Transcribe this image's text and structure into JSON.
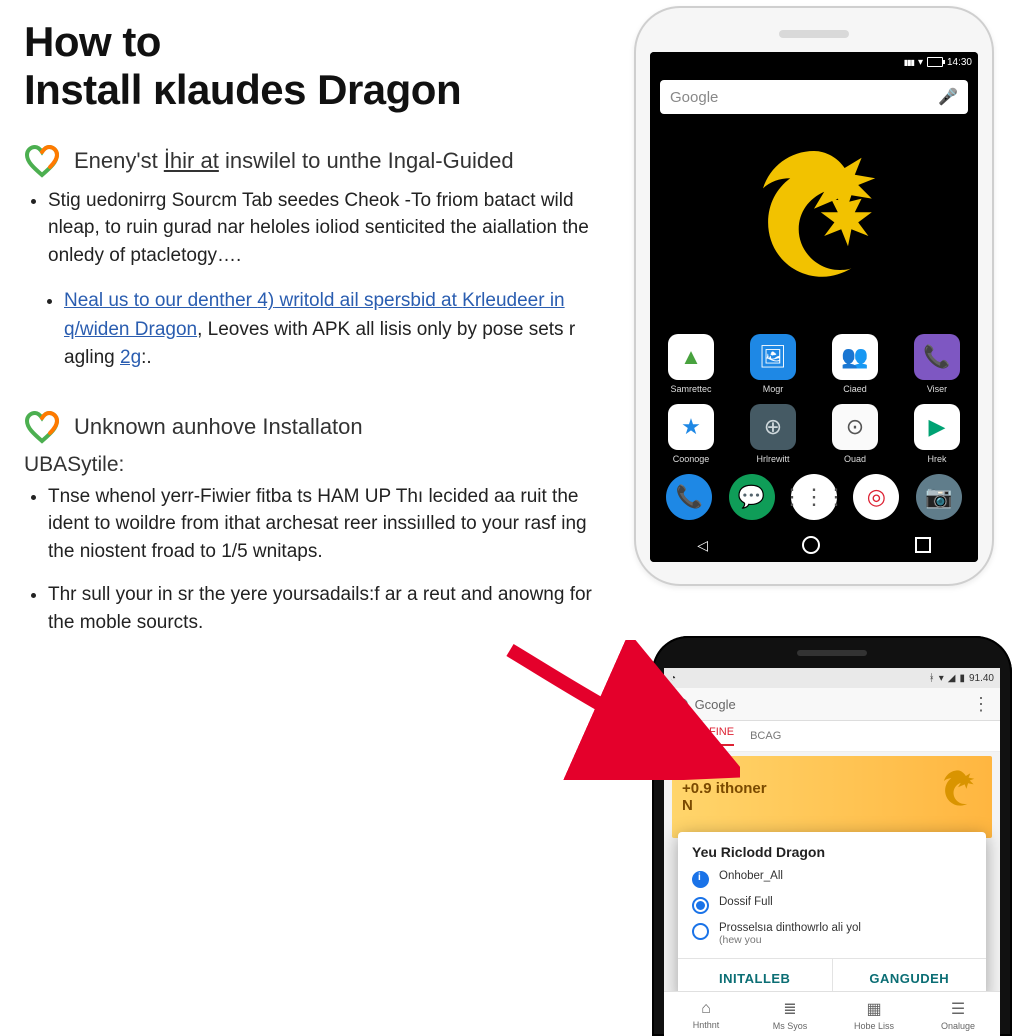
{
  "title_line1": "How to",
  "title_line2": "Install ĸlaudes Dragon",
  "step1": {
    "heading_pre": "Eneny'st ",
    "heading_link": "İhir at",
    "heading_post": " inswilel to unthe Ingal-Guided",
    "body": "Stig uedonirrg Sourcm Tab seedes Cheok -To friom batact wild nleap, to ruin gurad nar heloles ioliod senticited the aiallation the onledy of ptacletogy….",
    "subpoint_pre": "Neal us to our denther ",
    "subpoint_link1": "4)",
    "subpoint_mid1": " writold ail spersbid at ",
    "subpoint_link2": "Krleudeer in q/widen Dragon",
    "subpoint_mid2": ", Leoves with APK all lisis only by pose sets r agling ",
    "subpoint_link3": "2g",
    "subpoint_end": ":."
  },
  "step2": {
    "heading": "Unknown aunhove Installaton",
    "sublabel": "UBASytile:",
    "body1": "Tnse whenol yerr-Fiwier fitba ts HAM UP Thı lecided aa ruit the ident to woildre from ithat archesat reer inssiılled to your rasf ing the niostent froad to 1/5 wnitaps.",
    "body2": "Thr sull your in sr the yere yoursadails:f ar a reut and anowng for the moble sourcts."
  },
  "phone1": {
    "status_time": "14:30",
    "search_placeholder": "Google",
    "row1": [
      {
        "label": "Samrettec",
        "glyph": "▲",
        "bg": "#ffffff",
        "fg": "#48a23e"
      },
      {
        "label": "Mogr",
        "glyph": "🖼",
        "bg": "#1e88e5",
        "fg": "#fff"
      },
      {
        "label": "Ciaed",
        "glyph": "👥",
        "bg": "#fe2e2",
        "fg": "#333"
      },
      {
        "label": "Viser",
        "glyph": "📞",
        "bg": "#7e57c2",
        "fg": "#fff"
      }
    ],
    "row2": [
      {
        "label": "Coonoge",
        "glyph": "★",
        "bg": "#ffffff",
        "fg": "#1e88e5"
      },
      {
        "label": "Hrlrewitt",
        "glyph": "⊕",
        "bg": "#455a64",
        "fg": "#cfd8dc"
      },
      {
        "label": "Ouad",
        "glyph": "⊙",
        "bg": "#fafafa",
        "fg": "#555"
      },
      {
        "label": "Hrek",
        "glyph": "▶",
        "bg": "#ffffff",
        "fg": "#00a273"
      }
    ],
    "tray": [
      {
        "name": "dialer",
        "glyph": "📞",
        "bg": "#1e88e5",
        "fg": "#fff"
      },
      {
        "name": "messages",
        "glyph": "💬",
        "bg": "#0f9d58",
        "fg": "#fff"
      },
      {
        "name": "apps",
        "glyph": "⋮⋮⋮",
        "bg": "#ffffff",
        "fg": "#555"
      },
      {
        "name": "chrome",
        "glyph": "◎",
        "bg": "#ffffff",
        "fg": "#d23"
      },
      {
        "name": "camera",
        "glyph": "📷",
        "bg": "#607d8b",
        "fg": "#fff"
      }
    ]
  },
  "phone2": {
    "status_time": "91.40",
    "address": "Gcogle",
    "tabs": {
      "active": "LUOE FINE",
      "inactive": "BCAG"
    },
    "promo_line1": "+0.9 ithoner",
    "promo_line2": "N",
    "dialog": {
      "title": "Yeu Riclodd Dragon",
      "opt1": "Onhober_All",
      "opt2": "Dossif Full",
      "opt3_main": "Prosselsıa dinthowrlo ali yol",
      "opt3_sub": "(hew you",
      "action_left": "INITALLEB",
      "action_right": "GANGUDEH"
    },
    "bottom_tabs": [
      "Hnthnt",
      "Ms Syos",
      "Hobe Liss",
      "Onaluge"
    ],
    "bottom_icons": [
      "⌂",
      "≣",
      "▦",
      "☰"
    ]
  }
}
